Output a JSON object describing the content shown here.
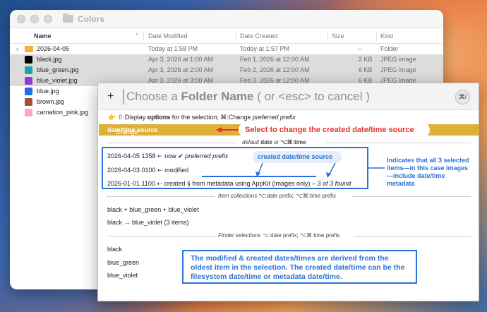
{
  "finder": {
    "window_title": "Colors",
    "columns": {
      "name": "Name",
      "date_modified": "Date Modified",
      "date_created": "Date Created",
      "size": "Size",
      "kind": "Kind"
    },
    "rows": [
      {
        "name": "2026-04-05",
        "modified": "Today at 1:58 PM",
        "created": "Today at 1:57 PM",
        "size": "--",
        "kind": "Folder",
        "icon": "folder",
        "color": "#f2b233",
        "selected": false
      },
      {
        "name": "black.jpg",
        "modified": "Apr 3, 2026 at 1:00 AM",
        "created": "Feb 1, 2026 at 12:00 AM",
        "size": "2 KB",
        "kind": "JPEG image",
        "color": "#000000",
        "selected": true
      },
      {
        "name": "blue_green.jpg",
        "modified": "Apr 3, 2026 at 2:00 AM",
        "created": "Feb 2, 2026 at 12:00 AM",
        "size": "6 KB",
        "kind": "JPEG image",
        "color": "#1aa6a6",
        "selected": true
      },
      {
        "name": "blue_violet.jpg",
        "modified": "Apr 3, 2026 at 3:00 AM",
        "created": "Feb 3, 2026 at 12:00 AM",
        "size": "6 KB",
        "kind": "JPEG image",
        "color": "#8a3fd8",
        "selected": true
      },
      {
        "name": "blue.jpg",
        "color": "#1f6fe6",
        "selected": false
      },
      {
        "name": "brown.jpg",
        "color": "#a5502e",
        "selected": false
      },
      {
        "name": "carnation_pink.jpg",
        "color": "#f6a8c6",
        "selected": false
      }
    ]
  },
  "panel": {
    "prompt_pre": "Choose a ",
    "prompt_bold": "Folder Name",
    "prompt_post": " ( or <esc> to cancel )",
    "badge": "⌘/",
    "hint_pre": "👉 ⇧:Display ",
    "hint_bold": "options",
    "hint_mid": " for the selection; ⌘:Change ",
    "hint_italic": "preferred prefix",
    "highlight_pre": "Change created ",
    "highlight_bold": "date/time source",
    "section1_pre": "default ",
    "section1_bold": "date",
    "section1_mid": " or ",
    "section1_post": "⌥⌘:time",
    "item1_pre": "2026-04-05 1358 ⇠ now ✔ ",
    "item1_italic": "preferred prefix",
    "item2": "2026-04-03 0100 ⇠ modified",
    "item3_pre": "2026-01-01 1100 ⇠ created  § from metadata using AppKit (images only) – 3 ",
    "item3_italic": "of 3 found",
    "section2_italic": "Item collections",
    "section2_rest": "  ⌥:date prefix; ⌥⌘:time prefix",
    "collection1": "black + blue_green + blue_violet",
    "collection2": "black → blue_violet (3 items)",
    "section3_italic": "Finder selections",
    "section3_rest": "  ⌥:date prefix; ⌥⌘:time prefix",
    "selection": [
      "black",
      "blue_green",
      "blue_violet"
    ]
  },
  "annotations": {
    "red": "Select to change the created date/time source",
    "blue_pill": "created date/time source",
    "right": "Indicates that all 3 selected items—in this case images—include date/time metadata",
    "bottom": "The modified & created dates/times are derived from the oldest item in the selection. The created date/time can be the filesystem date/time or metadata date/time.",
    "colors": {
      "red": "#e5332a",
      "blue": "#2a72d6",
      "highlight": "#deb03a"
    }
  }
}
